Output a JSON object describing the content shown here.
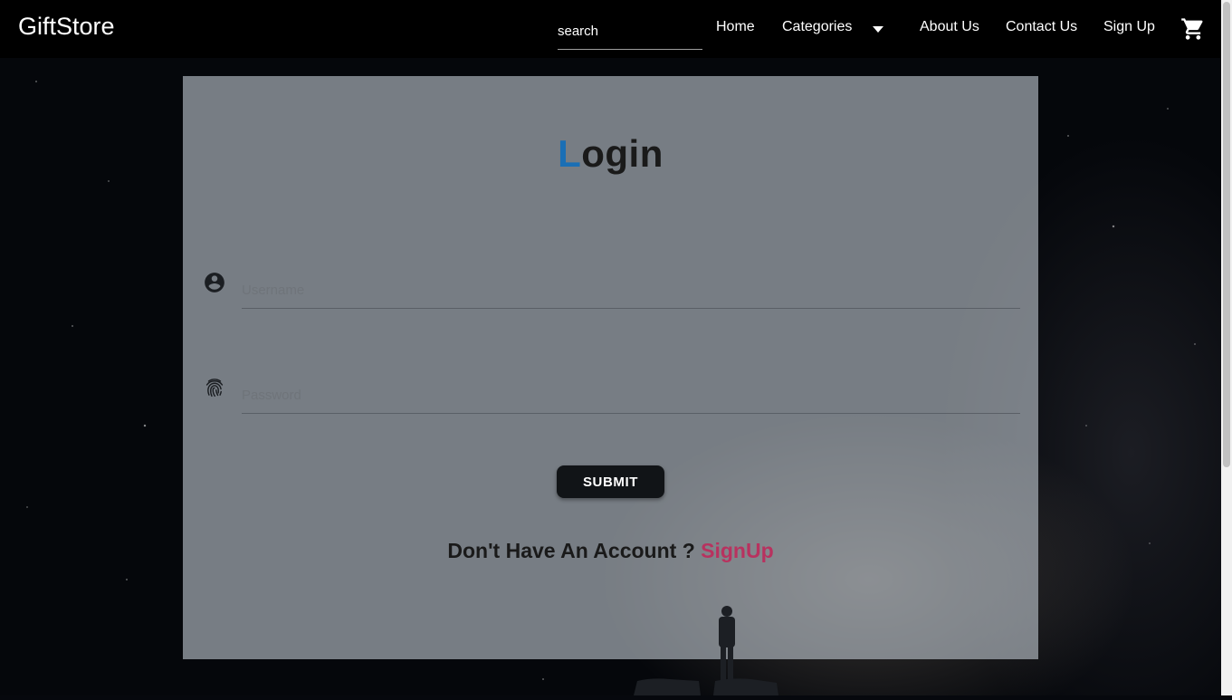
{
  "navbar": {
    "brand": "GiftStore",
    "search_placeholder": "search",
    "links": {
      "home": "Home",
      "categories": "Categories",
      "about": "About Us",
      "contact": "Contact Us",
      "signup": "Sign Up"
    },
    "icons": {
      "dropdown": "arrow-drop-down-icon",
      "cart": "shopping-cart-icon"
    }
  },
  "login": {
    "title_first": "L",
    "title_rest": "ogin",
    "username_placeholder": "Username",
    "password_placeholder": "Password",
    "icons": {
      "username": "account-circle-icon",
      "password": "fingerprint-icon"
    },
    "submit_label": "SUBMIT",
    "account_prompt": "Don't Have An Account ?",
    "signup_link": "SignUp"
  },
  "colors": {
    "accent_blue": "#1a6fb5",
    "signup_pink": "#b8325f",
    "navbar_bg": "#000000"
  }
}
